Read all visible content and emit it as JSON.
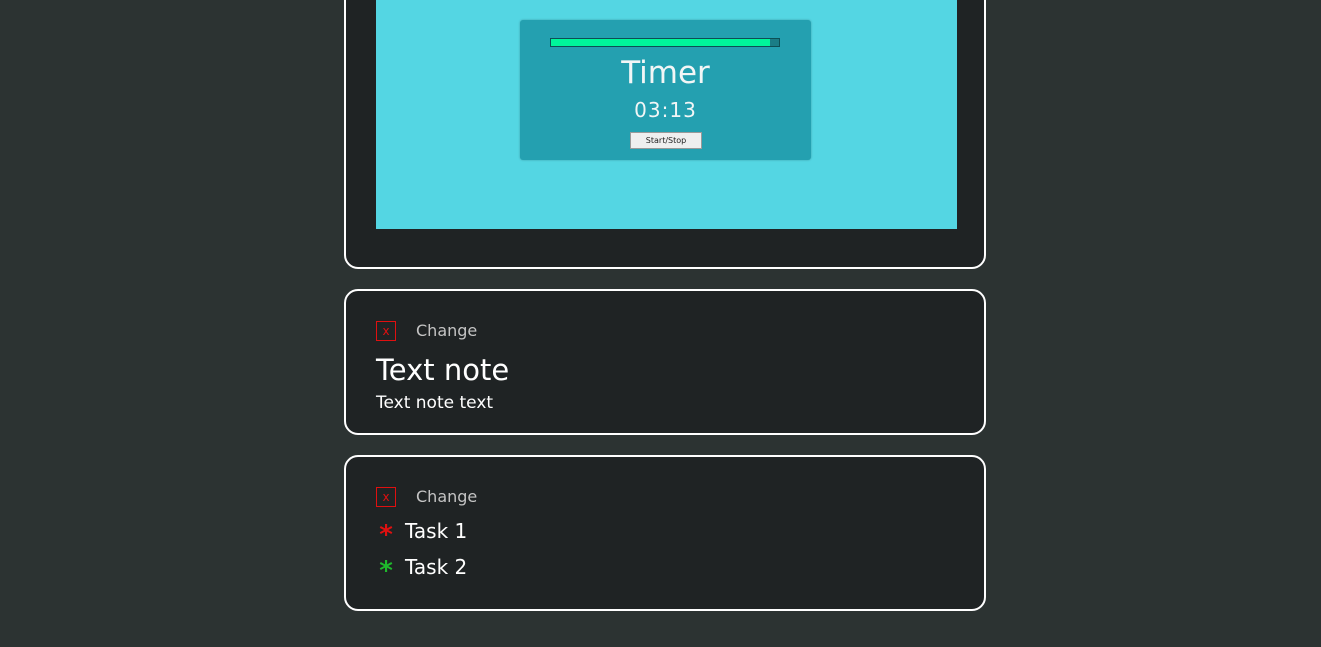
{
  "timer_card": {
    "widget": {
      "title": "Timer",
      "time": "03:13",
      "button_label": "Start/Stop",
      "progress": 0.96,
      "colors": {
        "background": "#54d6e3",
        "panel": "#24a0b0",
        "progress": "#00f59a"
      }
    }
  },
  "text_note_card": {
    "delete_label": "x",
    "change_label": "Change",
    "title": "Text note",
    "body": "Text note text"
  },
  "task_card": {
    "delete_label": "x",
    "change_label": "Change",
    "tasks": [
      {
        "label": "Task 1",
        "marker": "*",
        "color": "#e01010",
        "status": "pending"
      },
      {
        "label": "Task 2",
        "marker": "*",
        "color": "#1fb82c",
        "status": "done"
      }
    ]
  },
  "colors": {
    "page_background": "#2c3332",
    "card_background": "#1f2324",
    "card_border": "#ffffff",
    "delete_red": "#e01010"
  }
}
